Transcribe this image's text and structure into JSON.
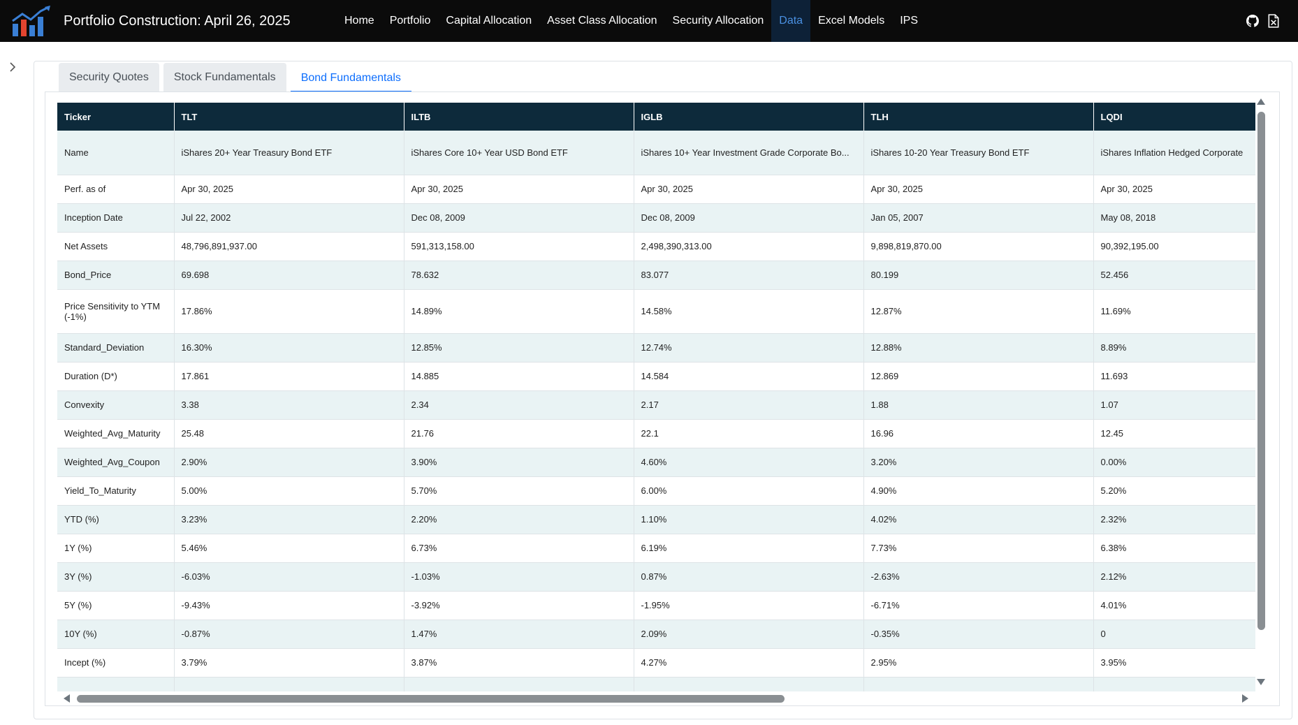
{
  "navbar": {
    "brand": "Portfolio Construction: April 26, 2025",
    "links": [
      {
        "label": "Home",
        "active": false
      },
      {
        "label": "Portfolio",
        "active": false
      },
      {
        "label": "Capital Allocation",
        "active": false
      },
      {
        "label": "Asset Class Allocation",
        "active": false
      },
      {
        "label": "Security Allocation",
        "active": false
      },
      {
        "label": "Data",
        "active": true
      },
      {
        "label": "Excel Models",
        "active": false
      },
      {
        "label": "IPS",
        "active": false
      }
    ],
    "icons": [
      "github-icon",
      "excel-file-icon"
    ],
    "accent_color": "#4a90e2"
  },
  "tabs": [
    {
      "label": "Security Quotes",
      "active": false
    },
    {
      "label": "Stock Fundamentals",
      "active": false
    },
    {
      "label": "Bond Fundamentals",
      "active": true
    }
  ],
  "table": {
    "header_color": "#0d2a3b",
    "columns": [
      "Ticker",
      "TLT",
      "ILTB",
      "IGLB",
      "TLH",
      "LQDI"
    ],
    "rows": [
      {
        "label": "Name",
        "values": [
          "iShares 20+ Year Treasury Bond ETF",
          "iShares Core 10+ Year USD Bond ETF",
          "iShares 10+ Year Investment Grade Corporate Bo...",
          "iShares 10-20 Year Treasury Bond ETF",
          "iShares Inflation Hedged Corporate"
        ]
      },
      {
        "label": "Perf. as of",
        "values": [
          "Apr 30, 2025",
          "Apr 30, 2025",
          "Apr 30, 2025",
          "Apr 30, 2025",
          "Apr 30, 2025"
        ]
      },
      {
        "label": "Inception Date",
        "values": [
          "Jul 22, 2002",
          "Dec 08, 2009",
          "Dec 08, 2009",
          "Jan 05, 2007",
          "May 08, 2018"
        ]
      },
      {
        "label": "Net Assets",
        "values": [
          "48,796,891,937.00",
          "591,313,158.00",
          "2,498,390,313.00",
          "9,898,819,870.00",
          "90,392,195.00"
        ]
      },
      {
        "label": "Bond_Price",
        "values": [
          "69.698",
          "78.632",
          "83.077",
          "80.199",
          "52.456"
        ]
      },
      {
        "label": "Price Sensitivity to YTM (-1%)",
        "values": [
          "17.86%",
          "14.89%",
          "14.58%",
          "12.87%",
          "11.69%"
        ]
      },
      {
        "label": "Standard_Deviation",
        "values": [
          "16.30%",
          "12.85%",
          "12.74%",
          "12.88%",
          "8.89%"
        ]
      },
      {
        "label": "Duration (D*)",
        "values": [
          "17.861",
          "14.885",
          "14.584",
          "12.869",
          "11.693"
        ]
      },
      {
        "label": "Convexity",
        "values": [
          "3.38",
          "2.34",
          "2.17",
          "1.88",
          "1.07"
        ]
      },
      {
        "label": "Weighted_Avg_Maturity",
        "values": [
          "25.48",
          "21.76",
          "22.1",
          "16.96",
          "12.45"
        ]
      },
      {
        "label": "Weighted_Avg_Coupon",
        "values": [
          "2.90%",
          "3.90%",
          "4.60%",
          "3.20%",
          "0.00%"
        ]
      },
      {
        "label": "Yield_To_Maturity",
        "values": [
          "5.00%",
          "5.70%",
          "6.00%",
          "4.90%",
          "5.20%"
        ]
      },
      {
        "label": "YTD (%)",
        "values": [
          "3.23%",
          "2.20%",
          "1.10%",
          "4.02%",
          "2.32%"
        ]
      },
      {
        "label": "1Y (%)",
        "values": [
          "5.46%",
          "6.73%",
          "6.19%",
          "7.73%",
          "6.38%"
        ]
      },
      {
        "label": "3Y (%)",
        "values": [
          "-6.03%",
          "-1.03%",
          "0.87%",
          "-2.63%",
          "2.12%"
        ]
      },
      {
        "label": "5Y (%)",
        "values": [
          "-9.43%",
          "-3.92%",
          "-1.95%",
          "-6.71%",
          "4.01%"
        ]
      },
      {
        "label": "10Y (%)",
        "values": [
          "-0.87%",
          "1.47%",
          "2.09%",
          "-0.35%",
          "0"
        ]
      },
      {
        "label": "Incept (%)",
        "values": [
          "3.79%",
          "3.87%",
          "4.27%",
          "2.95%",
          "3.95%"
        ]
      },
      {
        "label": "",
        "values": [
          "",
          "",
          "",
          "",
          ""
        ]
      }
    ]
  }
}
